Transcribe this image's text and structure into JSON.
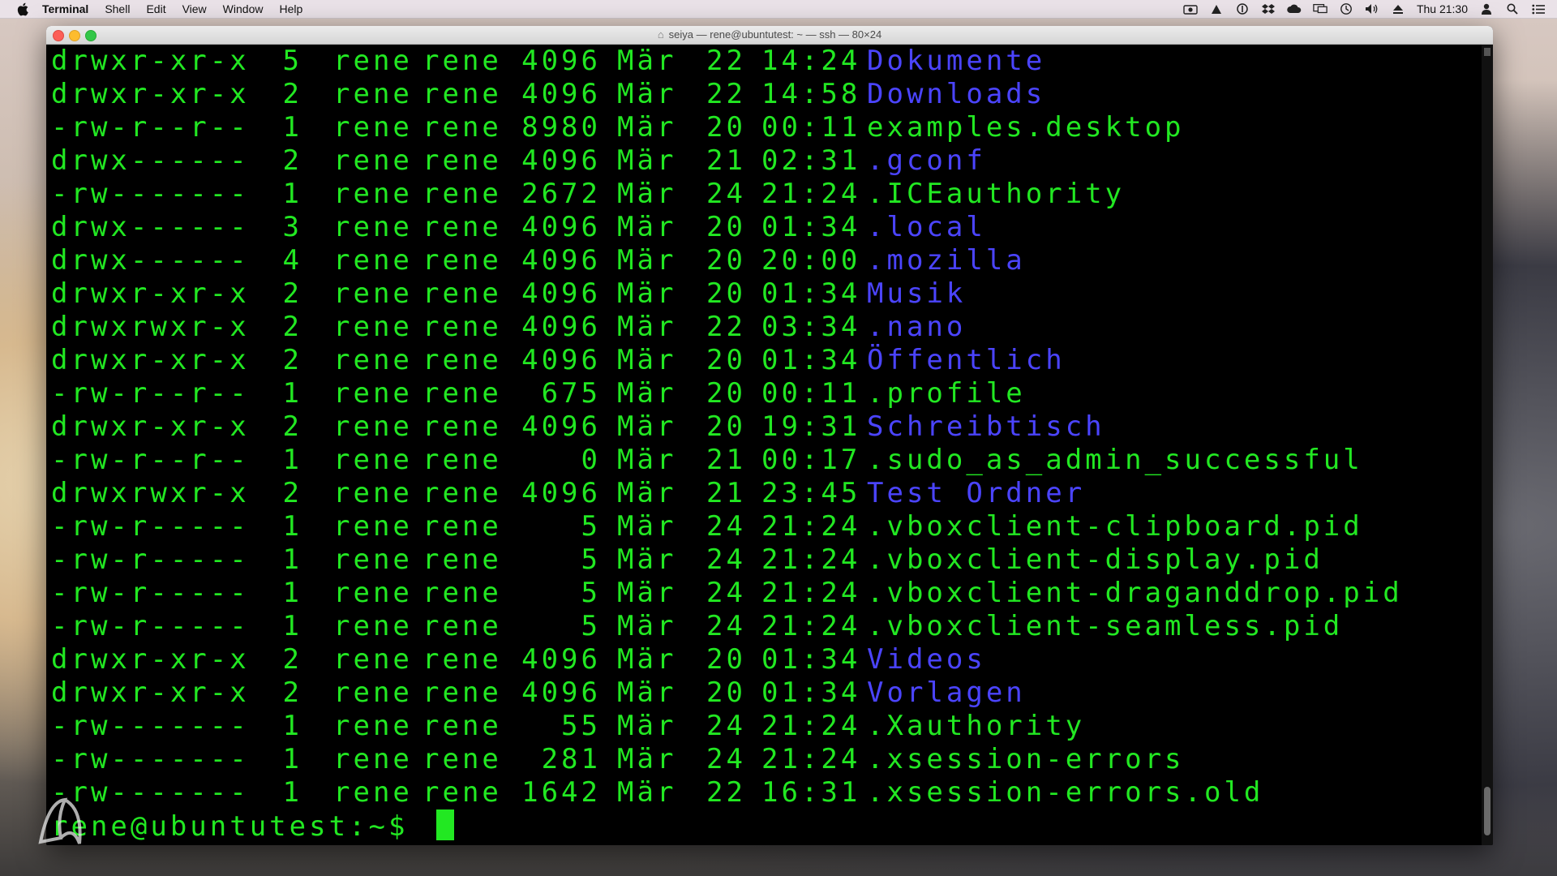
{
  "menubar": {
    "app": "Terminal",
    "items": [
      "Shell",
      "Edit",
      "View",
      "Window",
      "Help"
    ],
    "clock": "Thu 21:30",
    "icons": [
      "camera-icon",
      "drive-icon",
      "info-icon",
      "dropbox-icon",
      "cloud-icon",
      "display-icon",
      "time-machine-icon",
      "volume-icon",
      "eject-icon",
      "user-icon",
      "search-icon",
      "list-icon"
    ]
  },
  "window": {
    "title": "seiya — rene@ubuntutest: ~ — ssh — 80×24"
  },
  "terminal": {
    "rows": [
      {
        "perm": "drwxr-xr-x",
        "links": "5",
        "owner": "rene",
        "group": "rene",
        "size": "4096",
        "month": "Mär",
        "day": "22",
        "time": "14:24",
        "name": "Dokumente",
        "type": "dir"
      },
      {
        "perm": "drwxr-xr-x",
        "links": "2",
        "owner": "rene",
        "group": "rene",
        "size": "4096",
        "month": "Mär",
        "day": "22",
        "time": "14:58",
        "name": "Downloads",
        "type": "dir"
      },
      {
        "perm": "-rw-r--r--",
        "links": "1",
        "owner": "rene",
        "group": "rene",
        "size": "8980",
        "month": "Mär",
        "day": "20",
        "time": "00:11",
        "name": "examples.desktop",
        "type": "file"
      },
      {
        "perm": "drwx------",
        "links": "2",
        "owner": "rene",
        "group": "rene",
        "size": "4096",
        "month": "Mär",
        "day": "21",
        "time": "02:31",
        "name": ".gconf",
        "type": "dir"
      },
      {
        "perm": "-rw-------",
        "links": "1",
        "owner": "rene",
        "group": "rene",
        "size": "2672",
        "month": "Mär",
        "day": "24",
        "time": "21:24",
        "name": ".ICEauthority",
        "type": "file"
      },
      {
        "perm": "drwx------",
        "links": "3",
        "owner": "rene",
        "group": "rene",
        "size": "4096",
        "month": "Mär",
        "day": "20",
        "time": "01:34",
        "name": ".local",
        "type": "dir"
      },
      {
        "perm": "drwx------",
        "links": "4",
        "owner": "rene",
        "group": "rene",
        "size": "4096",
        "month": "Mär",
        "day": "20",
        "time": "20:00",
        "name": ".mozilla",
        "type": "dir"
      },
      {
        "perm": "drwxr-xr-x",
        "links": "2",
        "owner": "rene",
        "group": "rene",
        "size": "4096",
        "month": "Mär",
        "day": "20",
        "time": "01:34",
        "name": "Musik",
        "type": "dir"
      },
      {
        "perm": "drwxrwxr-x",
        "links": "2",
        "owner": "rene",
        "group": "rene",
        "size": "4096",
        "month": "Mär",
        "day": "22",
        "time": "03:34",
        "name": ".nano",
        "type": "dir"
      },
      {
        "perm": "drwxr-xr-x",
        "links": "2",
        "owner": "rene",
        "group": "rene",
        "size": "4096",
        "month": "Mär",
        "day": "20",
        "time": "01:34",
        "name": "Öffentlich",
        "type": "dir"
      },
      {
        "perm": "-rw-r--r--",
        "links": "1",
        "owner": "rene",
        "group": "rene",
        "size": "675",
        "month": "Mär",
        "day": "20",
        "time": "00:11",
        "name": ".profile",
        "type": "file"
      },
      {
        "perm": "drwxr-xr-x",
        "links": "2",
        "owner": "rene",
        "group": "rene",
        "size": "4096",
        "month": "Mär",
        "day": "20",
        "time": "19:31",
        "name": "Schreibtisch",
        "type": "dir"
      },
      {
        "perm": "-rw-r--r--",
        "links": "1",
        "owner": "rene",
        "group": "rene",
        "size": "0",
        "month": "Mär",
        "day": "21",
        "time": "00:17",
        "name": ".sudo_as_admin_successful",
        "type": "file"
      },
      {
        "perm": "drwxrwxr-x",
        "links": "2",
        "owner": "rene",
        "group": "rene",
        "size": "4096",
        "month": "Mär",
        "day": "21",
        "time": "23:45",
        "name": "Test Ordner",
        "type": "dir"
      },
      {
        "perm": "-rw-r-----",
        "links": "1",
        "owner": "rene",
        "group": "rene",
        "size": "5",
        "month": "Mär",
        "day": "24",
        "time": "21:24",
        "name": ".vboxclient-clipboard.pid",
        "type": "file"
      },
      {
        "perm": "-rw-r-----",
        "links": "1",
        "owner": "rene",
        "group": "rene",
        "size": "5",
        "month": "Mär",
        "day": "24",
        "time": "21:24",
        "name": ".vboxclient-display.pid",
        "type": "file"
      },
      {
        "perm": "-rw-r-----",
        "links": "1",
        "owner": "rene",
        "group": "rene",
        "size": "5",
        "month": "Mär",
        "day": "24",
        "time": "21:24",
        "name": ".vboxclient-draganddrop.pid",
        "type": "file"
      },
      {
        "perm": "-rw-r-----",
        "links": "1",
        "owner": "rene",
        "group": "rene",
        "size": "5",
        "month": "Mär",
        "day": "24",
        "time": "21:24",
        "name": ".vboxclient-seamless.pid",
        "type": "file"
      },
      {
        "perm": "drwxr-xr-x",
        "links": "2",
        "owner": "rene",
        "group": "rene",
        "size": "4096",
        "month": "Mär",
        "day": "20",
        "time": "01:34",
        "name": "Videos",
        "type": "dir"
      },
      {
        "perm": "drwxr-xr-x",
        "links": "2",
        "owner": "rene",
        "group": "rene",
        "size": "4096",
        "month": "Mär",
        "day": "20",
        "time": "01:34",
        "name": "Vorlagen",
        "type": "dir"
      },
      {
        "perm": "-rw-------",
        "links": "1",
        "owner": "rene",
        "group": "rene",
        "size": "55",
        "month": "Mär",
        "day": "24",
        "time": "21:24",
        "name": ".Xauthority",
        "type": "file"
      },
      {
        "perm": "-rw-------",
        "links": "1",
        "owner": "rene",
        "group": "rene",
        "size": "281",
        "month": "Mär",
        "day": "24",
        "time": "21:24",
        "name": ".xsession-errors",
        "type": "file"
      },
      {
        "perm": "-rw-------",
        "links": "1",
        "owner": "rene",
        "group": "rene",
        "size": "1642",
        "month": "Mär",
        "day": "22",
        "time": "16:31",
        "name": ".xsession-errors.old",
        "type": "file"
      }
    ],
    "prompt": "rene@ubuntutest:~$ "
  },
  "colors": {
    "text": "#22e822",
    "directory": "#4b44ff",
    "background": "#000000"
  }
}
